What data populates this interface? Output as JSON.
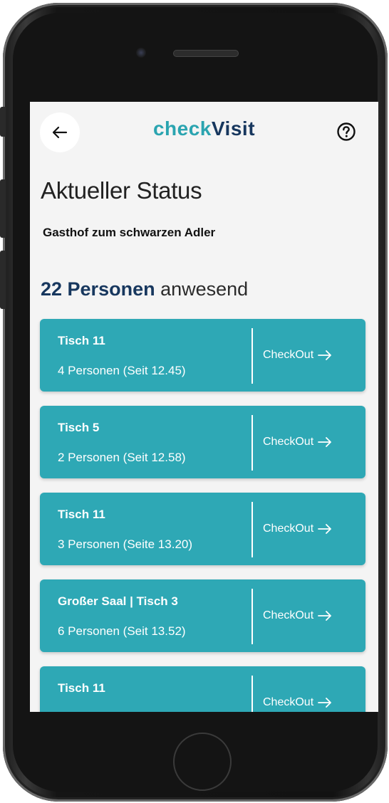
{
  "header": {
    "logo_part1": "check",
    "logo_part2": "Visit"
  },
  "page": {
    "title": "Aktueller Status",
    "venue": "Gasthof zum schwarzen Adler",
    "count_bold": "22 Personen",
    "count_rest": "anwesend"
  },
  "visits": [
    {
      "name": "Tisch 11",
      "info": "4 Personen (Seit 12.45)",
      "action": "CheckOut"
    },
    {
      "name": "Tisch 5",
      "info": "2 Personen (Seit 12.58)",
      "action": "CheckOut"
    },
    {
      "name": "Tisch 11",
      "info": "3 Personen (Seite 13.20)",
      "action": "CheckOut"
    },
    {
      "name": "Großer Saal | Tisch 3",
      "info": "6 Personen (Seit 13.52)",
      "action": "CheckOut"
    },
    {
      "name": "Tisch 11",
      "info": "",
      "action": "CheckOut"
    }
  ],
  "icons": {
    "back": "arrow-left-icon",
    "help": "question-circle-icon",
    "checkout": "arrow-right-icon"
  },
  "colors": {
    "accent": "#2ea8b5",
    "brand_dark": "#17375e",
    "background": "#f4f4f4"
  }
}
